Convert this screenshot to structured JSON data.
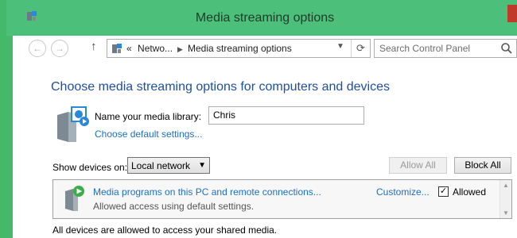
{
  "window": {
    "title": "Media streaming options",
    "accent": "#4cc07a",
    "close_color": "#c0392b"
  },
  "navbar": {
    "back_icon": "back-arrow-icon",
    "forward_icon": "forward-arrow-icon",
    "up_icon": "up-arrow-icon",
    "breadcrumb_prefix": "«",
    "breadcrumb": [
      "Netwo...",
      "Media streaming options"
    ],
    "refresh_icon": "refresh-icon",
    "search_placeholder": "Search Control Panel"
  },
  "main": {
    "heading": "Choose media streaming options for computers and devices",
    "library_label": "Name your media library:",
    "library_value": "Chris",
    "default_settings_link": "Choose default settings...",
    "show_devices_label": "Show devices on:",
    "show_devices_value": "Local network",
    "allow_all_label": "Allow All",
    "block_all_label": "Block All",
    "link_color": "#1e6fc0"
  },
  "devices": [
    {
      "name": "Media programs on this PC and remote connections...",
      "status": "Allowed access using default settings.",
      "customize_label": "Customize...",
      "allowed_label": "Allowed",
      "allowed_checked": true,
      "check_mark": "✓"
    }
  ],
  "footer": {
    "text": "All devices are allowed to access your shared media."
  }
}
